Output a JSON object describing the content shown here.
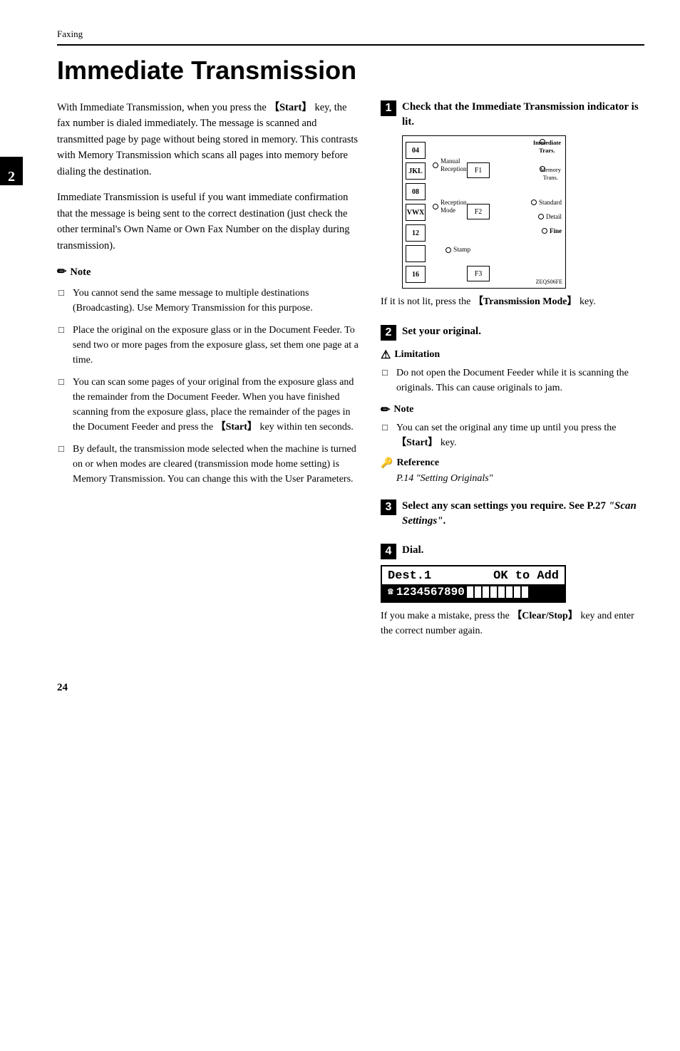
{
  "meta": {
    "section": "Faxing",
    "chapter_num": "2",
    "page_number": "24"
  },
  "title": "Immediate Transmission",
  "intro_paragraphs": [
    "With Immediate Transmission, when you press the 【Start】 key, the fax number is dialed immediately. The message is scanned and transmitted page by page without being stored in memory. This contrasts with Memory Transmission which scans all pages into memory before dialing the destination.",
    "Immediate Transmission is useful if you want immediate confirmation that the message is being sent to the correct destination (just check the other terminal's Own Name or Own Fax Number on the display during transmission)."
  ],
  "note_heading": "Note",
  "note_items": [
    "You cannot send the same message to multiple destinations (Broadcasting). Use Memory Transmission for this purpose.",
    "Place the original on the exposure glass or in the Document Feeder. To send two or more pages from the exposure glass, set them one page at a time.",
    "You can scan some pages of your original from the exposure glass and the remainder from the Document Feeder. When you have finished scanning from the exposure glass, place the remainder of the pages in the Document Feeder and press the 【Start】 key within ten seconds.",
    "By default, the transmission mode selected when the machine is turned on or when modes are cleared (transmission mode home setting) is Memory Transmission. You can change this with the User Parameters."
  ],
  "steps": [
    {
      "num": "1",
      "title": "Check that the Immediate Transmission indicator is lit.",
      "body_after": "If it is not lit, press the 【Transmission Mode】 key."
    },
    {
      "num": "2",
      "title": "Set your original.",
      "limitation_heading": "Limitation",
      "limitation_items": [
        "Do not open the Document Feeder while it is scanning the originals. This can cause originals to jam."
      ],
      "note_heading": "Note",
      "note_items": [
        "You can set the original any time up until you press the 【Start】 key."
      ],
      "reference_heading": "Reference",
      "reference_text": "P.14 \"Setting Originals\""
    },
    {
      "num": "3",
      "title": "Select any scan settings you require. See P.27 \"Scan Settings\"."
    },
    {
      "num": "4",
      "title": "Dial.",
      "dial_display": {
        "row1_left": "Dest.1",
        "row1_right": "OK to Add",
        "row2_icon": "☎",
        "row2_text": "1234567890"
      },
      "body_after": "If you make a mistake, press the 【Clear/Stop】 key and enter the correct number again."
    }
  ],
  "panel": {
    "rows_left": [
      "04",
      "JKL",
      "08",
      "VWX",
      "12",
      "",
      "16"
    ],
    "fn_keys": [
      "F1",
      "F2",
      "F3"
    ],
    "immediate_label": "Immediate\nTrans.",
    "memory_trans_label": "Memory\nTrans.",
    "manual_reception": "Manual\nReception",
    "reception_mode": "Reception\nMode",
    "standard": "Standard",
    "detail": "Detail",
    "fine": "Fine",
    "stamp": "Stamp",
    "watermark": "ZEQS06FE"
  }
}
